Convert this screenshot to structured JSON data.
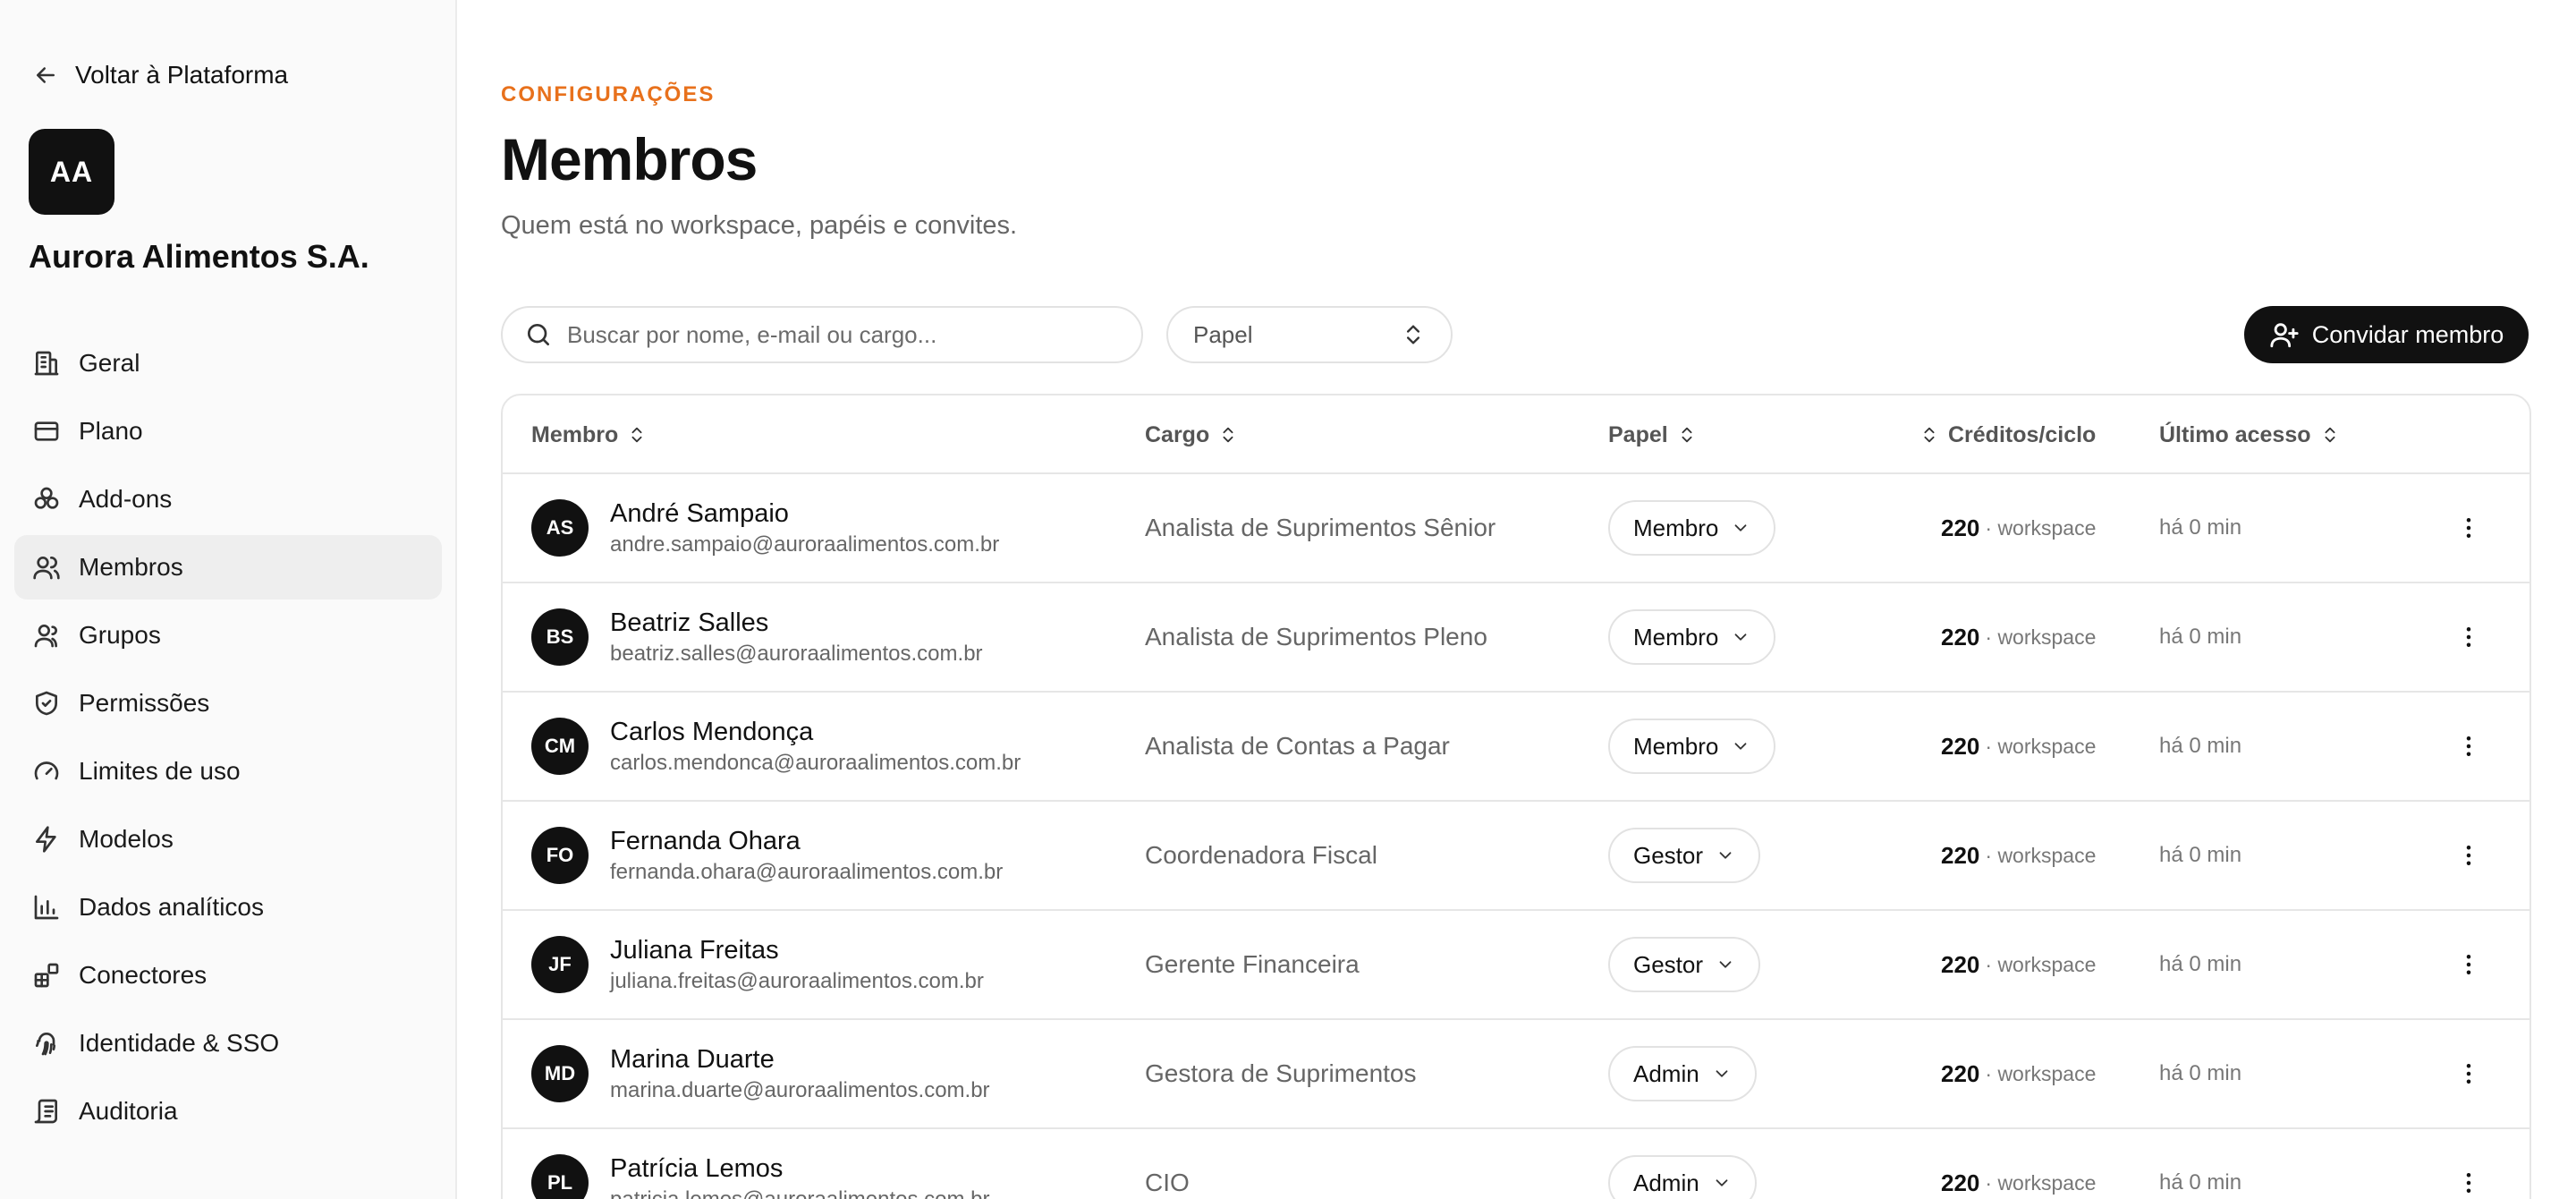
{
  "sidebar": {
    "back_label": "Voltar à Plataforma",
    "org": {
      "initials": "AA",
      "name": "Aurora Alimentos S.A."
    },
    "items": [
      {
        "label": "Geral",
        "icon": "building-icon",
        "active": false
      },
      {
        "label": "Plano",
        "icon": "credit-card-icon",
        "active": false
      },
      {
        "label": "Add-ons",
        "icon": "boxes-icon",
        "active": false
      },
      {
        "label": "Membros",
        "icon": "users-icon",
        "active": true
      },
      {
        "label": "Grupos",
        "icon": "group-icon",
        "active": false
      },
      {
        "label": "Permissões",
        "icon": "shield-icon",
        "active": false
      },
      {
        "label": "Limites de uso",
        "icon": "gauge-icon",
        "active": false
      },
      {
        "label": "Modelos",
        "icon": "bolt-icon",
        "active": false
      },
      {
        "label": "Dados analíticos",
        "icon": "bar-chart-icon",
        "active": false
      },
      {
        "label": "Conectores",
        "icon": "blocks-icon",
        "active": false
      },
      {
        "label": "Identidade & SSO",
        "icon": "fingerprint-icon",
        "active": false
      },
      {
        "label": "Auditoria",
        "icon": "scroll-icon",
        "active": false
      }
    ]
  },
  "header": {
    "eyebrow": "CONFIGURAÇÕES",
    "title": "Membros",
    "subtitle": "Quem está no workspace, papéis e convites."
  },
  "toolbar": {
    "search_placeholder": "Buscar por nome, e-mail ou cargo...",
    "role_filter_label": "Papel",
    "invite_label": "Convidar membro"
  },
  "table": {
    "columns": {
      "member": "Membro",
      "cargo": "Cargo",
      "role": "Papel",
      "credits": "Créditos/ciclo",
      "last_access": "Último acesso"
    },
    "rows": [
      {
        "initials": "AS",
        "name": "André Sampaio",
        "email": "andre.sampaio@auroraalimentos.com.br",
        "cargo": "Analista de Suprimentos Sênior",
        "role": "Membro",
        "credits": "220",
        "scope": "· workspace",
        "last_access": "há 0 min"
      },
      {
        "initials": "BS",
        "name": "Beatriz Salles",
        "email": "beatriz.salles@auroraalimentos.com.br",
        "cargo": "Analista de Suprimentos Pleno",
        "role": "Membro",
        "credits": "220",
        "scope": "· workspace",
        "last_access": "há 0 min"
      },
      {
        "initials": "CM",
        "name": "Carlos Mendonça",
        "email": "carlos.mendonca@auroraalimentos.com.br",
        "cargo": "Analista de Contas a Pagar",
        "role": "Membro",
        "credits": "220",
        "scope": "· workspace",
        "last_access": "há 0 min"
      },
      {
        "initials": "FO",
        "name": "Fernanda Ohara",
        "email": "fernanda.ohara@auroraalimentos.com.br",
        "cargo": "Coordenadora Fiscal",
        "role": "Gestor",
        "credits": "220",
        "scope": "· workspace",
        "last_access": "há 0 min"
      },
      {
        "initials": "JF",
        "name": "Juliana Freitas",
        "email": "juliana.freitas@auroraalimentos.com.br",
        "cargo": "Gerente Financeira",
        "role": "Gestor",
        "credits": "220",
        "scope": "· workspace",
        "last_access": "há 0 min"
      },
      {
        "initials": "MD",
        "name": "Marina Duarte",
        "email": "marina.duarte@auroraalimentos.com.br",
        "cargo": "Gestora de Suprimentos",
        "role": "Admin",
        "credits": "220",
        "scope": "· workspace",
        "last_access": "há 0 min"
      },
      {
        "initials": "PL",
        "name": "Patrícia Lemos",
        "email": "patricia.lemos@auroraalimentos.com.br",
        "cargo": "CIO",
        "role": "Admin",
        "credits": "220",
        "scope": "· workspace",
        "last_access": "há 0 min"
      }
    ]
  },
  "colors": {
    "accent": "#e8711c",
    "primary": "#111111",
    "muted_text": "#666666",
    "border": "#e6e6e6"
  }
}
